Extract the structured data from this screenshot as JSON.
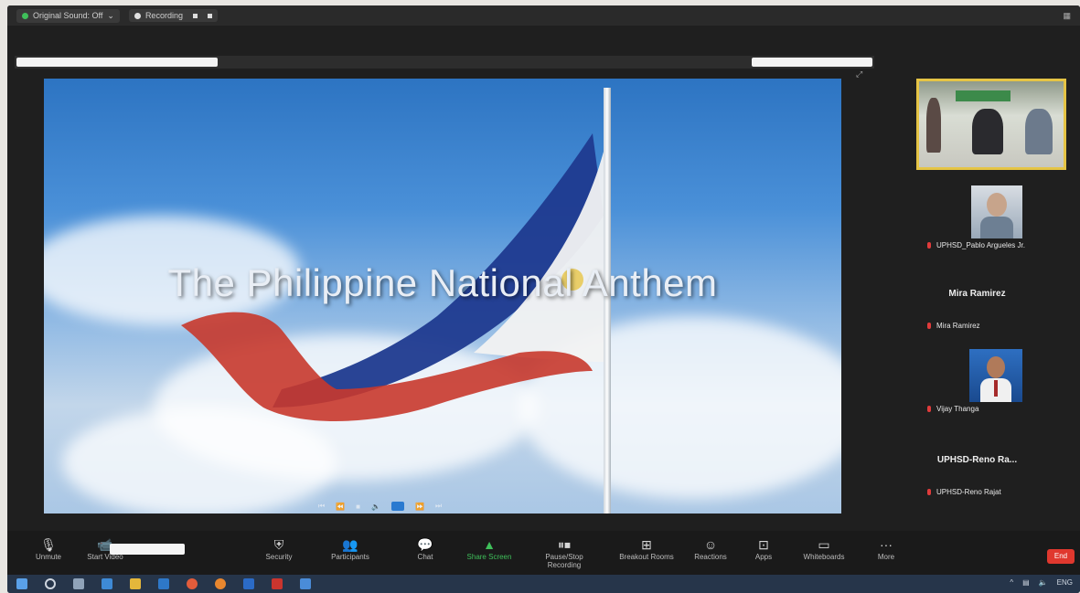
{
  "topbar": {
    "sound_label": "Original Sound: Off",
    "recording_label": "Recording"
  },
  "shared_content": {
    "title": "The Philippine National Anthem"
  },
  "gallery": {
    "participants": [
      {
        "label": "UPHSD_Pablo Argueles Jr."
      },
      {
        "name": "Mira Ramirez",
        "label": "Mira Ramirez"
      },
      {
        "label": "Vijay Thanga"
      },
      {
        "name": "UPHSD-Reno Ra...",
        "label": "UPHSD-Reno Rajat"
      }
    ]
  },
  "toolbar": {
    "items": [
      {
        "label": "Unmute",
        "icon": "microphone-icon"
      },
      {
        "label": "Start Video",
        "icon": "video-camera-icon"
      },
      {
        "label": "Security",
        "icon": "shield-icon"
      },
      {
        "label": "Participants",
        "icon": "participants-icon"
      },
      {
        "label": "Chat",
        "icon": "chat-icon"
      },
      {
        "label": "Share Screen",
        "icon": "share-screen-icon"
      },
      {
        "label": "Pause/Stop Recording",
        "icon": "record-icon"
      },
      {
        "label": "Breakout Rooms",
        "icon": "breakout-rooms-icon"
      },
      {
        "label": "Reactions",
        "icon": "reactions-icon"
      },
      {
        "label": "Apps",
        "icon": "apps-icon"
      },
      {
        "label": "Whiteboards",
        "icon": "whiteboard-icon"
      },
      {
        "label": "More",
        "icon": "more-icon"
      }
    ],
    "end_label": "End"
  },
  "taskbar": {
    "tray_lang": "ENG"
  },
  "colors": {
    "end_button": "#e0382e",
    "active_speaker_border": "#e5c445",
    "share_green": "#3fbf5a"
  }
}
